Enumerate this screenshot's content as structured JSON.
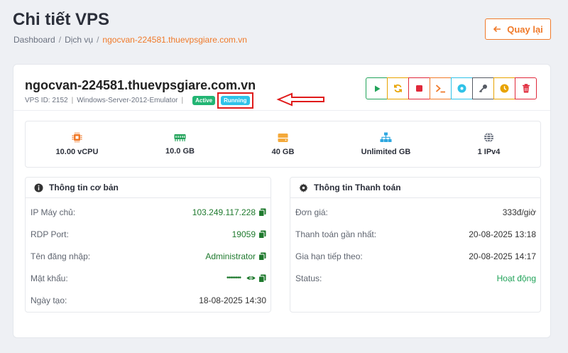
{
  "header": {
    "title": "Chi tiết VPS",
    "breadcrumb": [
      "Dashboard",
      "Dịch vụ",
      "ngocvan-224581.thuevpsgiare.com.vn"
    ],
    "back_label": "Quay lại"
  },
  "vps": {
    "hostname": "ngocvan-224581.thuevpsgiare.com.vn",
    "id_text": "VPS ID: 2152",
    "os": "Windows-Server-2012-Emulator",
    "status_badge": "Active",
    "power_badge": "Running"
  },
  "actions": [
    {
      "name": "start",
      "icon": "play-icon",
      "color": "#22a35a"
    },
    {
      "name": "restart",
      "icon": "refresh-icon",
      "color": "#e8a300"
    },
    {
      "name": "stop",
      "icon": "stop-icon",
      "color": "#e0283a"
    },
    {
      "name": "console",
      "icon": "terminal-icon",
      "color": "#f07a2a"
    },
    {
      "name": "reinstall",
      "icon": "disc-icon",
      "color": "#2fc2e8"
    },
    {
      "name": "password",
      "icon": "key-icon",
      "color": "#555a63"
    },
    {
      "name": "renew",
      "icon": "clock-icon",
      "color": "#e8a300"
    },
    {
      "name": "delete",
      "icon": "trash-icon",
      "color": "#e0283a"
    }
  ],
  "specs": {
    "cpu": "10.00 vCPU",
    "ram": "10.0 GB",
    "disk": "40 GB",
    "bandwidth": "Unlimited GB",
    "ip": "1 IPv4"
  },
  "basic": {
    "title": "Thông tin cơ bản",
    "ip_label": "IP Máy chủ:",
    "ip_value": "103.249.117.228",
    "rdp_label": "RDP Port:",
    "rdp_value": "19059",
    "user_label": "Tên đăng nhập:",
    "user_value": "Administrator",
    "pass_label": "Mật khẩu:",
    "pass_value": "••••••••",
    "created_label": "Ngày tạo:",
    "created_value": "18-08-2025 14:30"
  },
  "billing": {
    "title": "Thông tin Thanh toán",
    "price_label": "Đơn giá:",
    "price_value": "333đ/giờ",
    "last_label": "Thanh toán gần nhất:",
    "last_value": "20-08-2025 13:18",
    "next_label": "Gia hạn tiếp theo:",
    "next_value": "20-08-2025 14:17",
    "status_label": "Status:",
    "status_value": "Hoạt động"
  }
}
